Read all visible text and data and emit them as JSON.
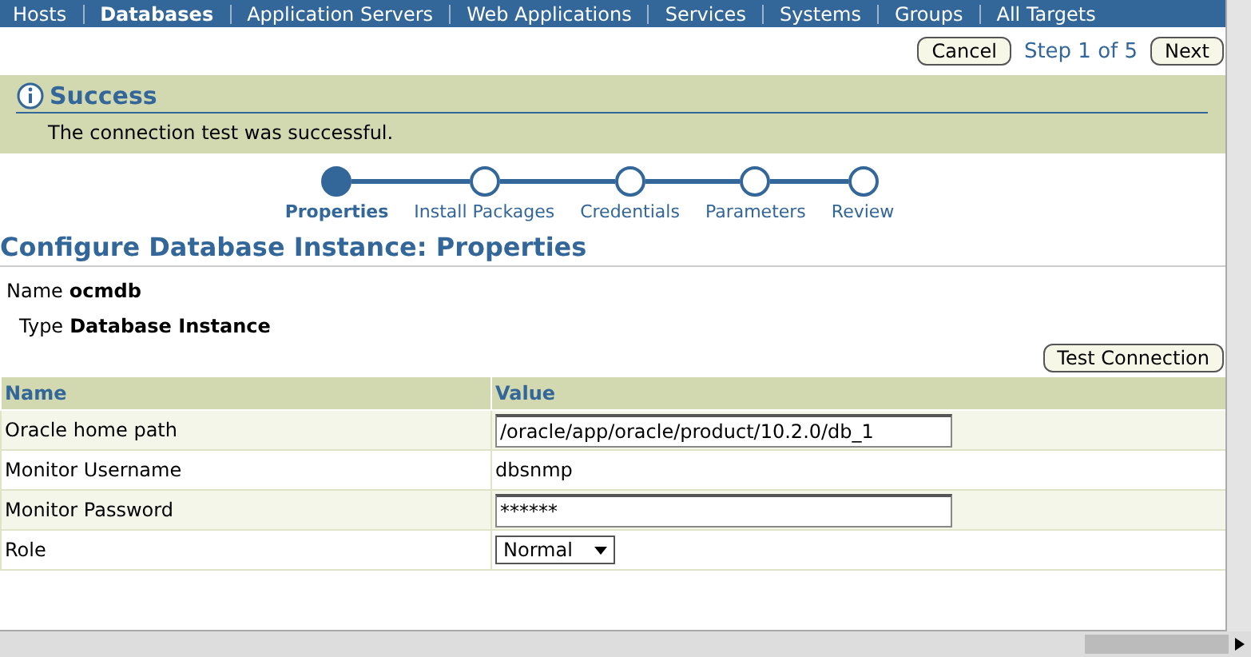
{
  "nav_tabs": [
    {
      "label": "Hosts",
      "selected": false
    },
    {
      "label": "Databases",
      "selected": true
    },
    {
      "label": "Application Servers",
      "selected": false
    },
    {
      "label": "Web Applications",
      "selected": false
    },
    {
      "label": "Services",
      "selected": false
    },
    {
      "label": "Systems",
      "selected": false
    },
    {
      "label": "Groups",
      "selected": false
    },
    {
      "label": "All Targets",
      "selected": false
    }
  ],
  "top_actions": {
    "cancel": "Cancel",
    "step": "Step 1 of 5",
    "next": "Next"
  },
  "message": {
    "title": "Success",
    "text": "The connection test was successful."
  },
  "train": [
    {
      "label": "Properties",
      "selected": true
    },
    {
      "label": "Install Packages",
      "selected": false
    },
    {
      "label": "Credentials",
      "selected": false
    },
    {
      "label": "Parameters",
      "selected": false
    },
    {
      "label": "Review",
      "selected": false
    }
  ],
  "heading": "Configure Database Instance: Properties",
  "info": [
    {
      "label": "Name",
      "value": "ocmdb"
    },
    {
      "label": "Type",
      "value": "Database Instance"
    }
  ],
  "test_button": "Test Connection",
  "table": {
    "columns": [
      "Name",
      "Value"
    ],
    "rows": [
      {
        "name": "Oracle home path",
        "kind": "input",
        "value": "/oracle/app/oracle/product/10.2.0/db_1"
      },
      {
        "name": "Monitor Username",
        "kind": "text",
        "value": "dbsnmp"
      },
      {
        "name": "Monitor Password",
        "kind": "input",
        "value": "******"
      },
      {
        "name": "Role",
        "kind": "select",
        "value": "Normal"
      }
    ]
  }
}
